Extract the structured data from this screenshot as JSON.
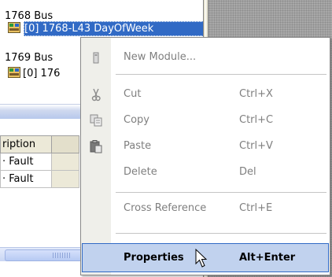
{
  "tree": {
    "items": [
      {
        "label": "1768 Bus"
      },
      {
        "label": "[0] 1768-L43 DayOfWeek"
      },
      {
        "label": "1769 Bus"
      },
      {
        "label": "[0] 176"
      }
    ]
  },
  "grid": {
    "header": "ription",
    "rows": [
      "Fault",
      "Fault"
    ]
  },
  "menu": {
    "items": [
      {
        "label": "New Module...",
        "icon": "new-module-icon"
      },
      {
        "label": "Cut",
        "shortcut": "Ctrl+X",
        "icon": "scissors-icon"
      },
      {
        "label": "Copy",
        "shortcut": "Ctrl+C",
        "icon": "copy-icon"
      },
      {
        "label": "Paste",
        "shortcut": "Ctrl+V",
        "icon": "paste-icon"
      },
      {
        "label": "Delete",
        "shortcut": "Del"
      },
      {
        "label": "Cross Reference",
        "shortcut": "Ctrl+E"
      },
      {
        "label": "Properties",
        "shortcut": "Alt+Enter",
        "highlighted": true
      }
    ]
  },
  "colors": {
    "selection": "#316ac5",
    "highlight_fill": "#c1d2ee",
    "disabled_text": "#7f7f7f"
  }
}
